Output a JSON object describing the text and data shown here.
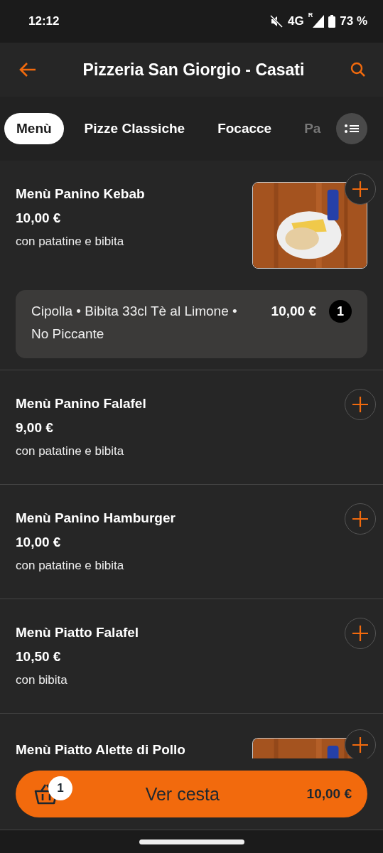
{
  "status_bar": {
    "time": "12:12",
    "network": "4G",
    "roaming": "R",
    "battery": "73 %"
  },
  "header": {
    "title": "Pizzeria San Giorgio - Casati"
  },
  "tabs": [
    {
      "label": "Menù",
      "selected": true
    },
    {
      "label": "Pizze Classiche",
      "selected": false
    },
    {
      "label": "Focacce",
      "selected": false
    },
    {
      "label": "Pa",
      "selected": false
    }
  ],
  "items": [
    {
      "kind": "picture",
      "name": "Menù Panino Kebab",
      "price": "10,00 €",
      "description": "con patatine e bibita",
      "cart_line": {
        "options": "Cipolla • Bibita 33cl Tè al Limone • No Piccante",
        "price": "10,00 €",
        "quantity": "1"
      }
    },
    {
      "kind": "plain",
      "name": "Menù Panino Falafel",
      "price": "9,00 €",
      "description": "con patatine e bibita"
    },
    {
      "kind": "plain",
      "name": "Menù Panino Hamburger",
      "price": "10,00 €",
      "description": "con patatine e bibita"
    },
    {
      "kind": "plain",
      "name": "Menù Piatto Falafel",
      "price": "10,50 €",
      "description": "con bibita"
    },
    {
      "kind": "picture",
      "name": "Menù Piatto Alette di Pollo"
    }
  ],
  "cart": {
    "count": "1",
    "label": "Ver cesta",
    "total": "10,00 €"
  }
}
